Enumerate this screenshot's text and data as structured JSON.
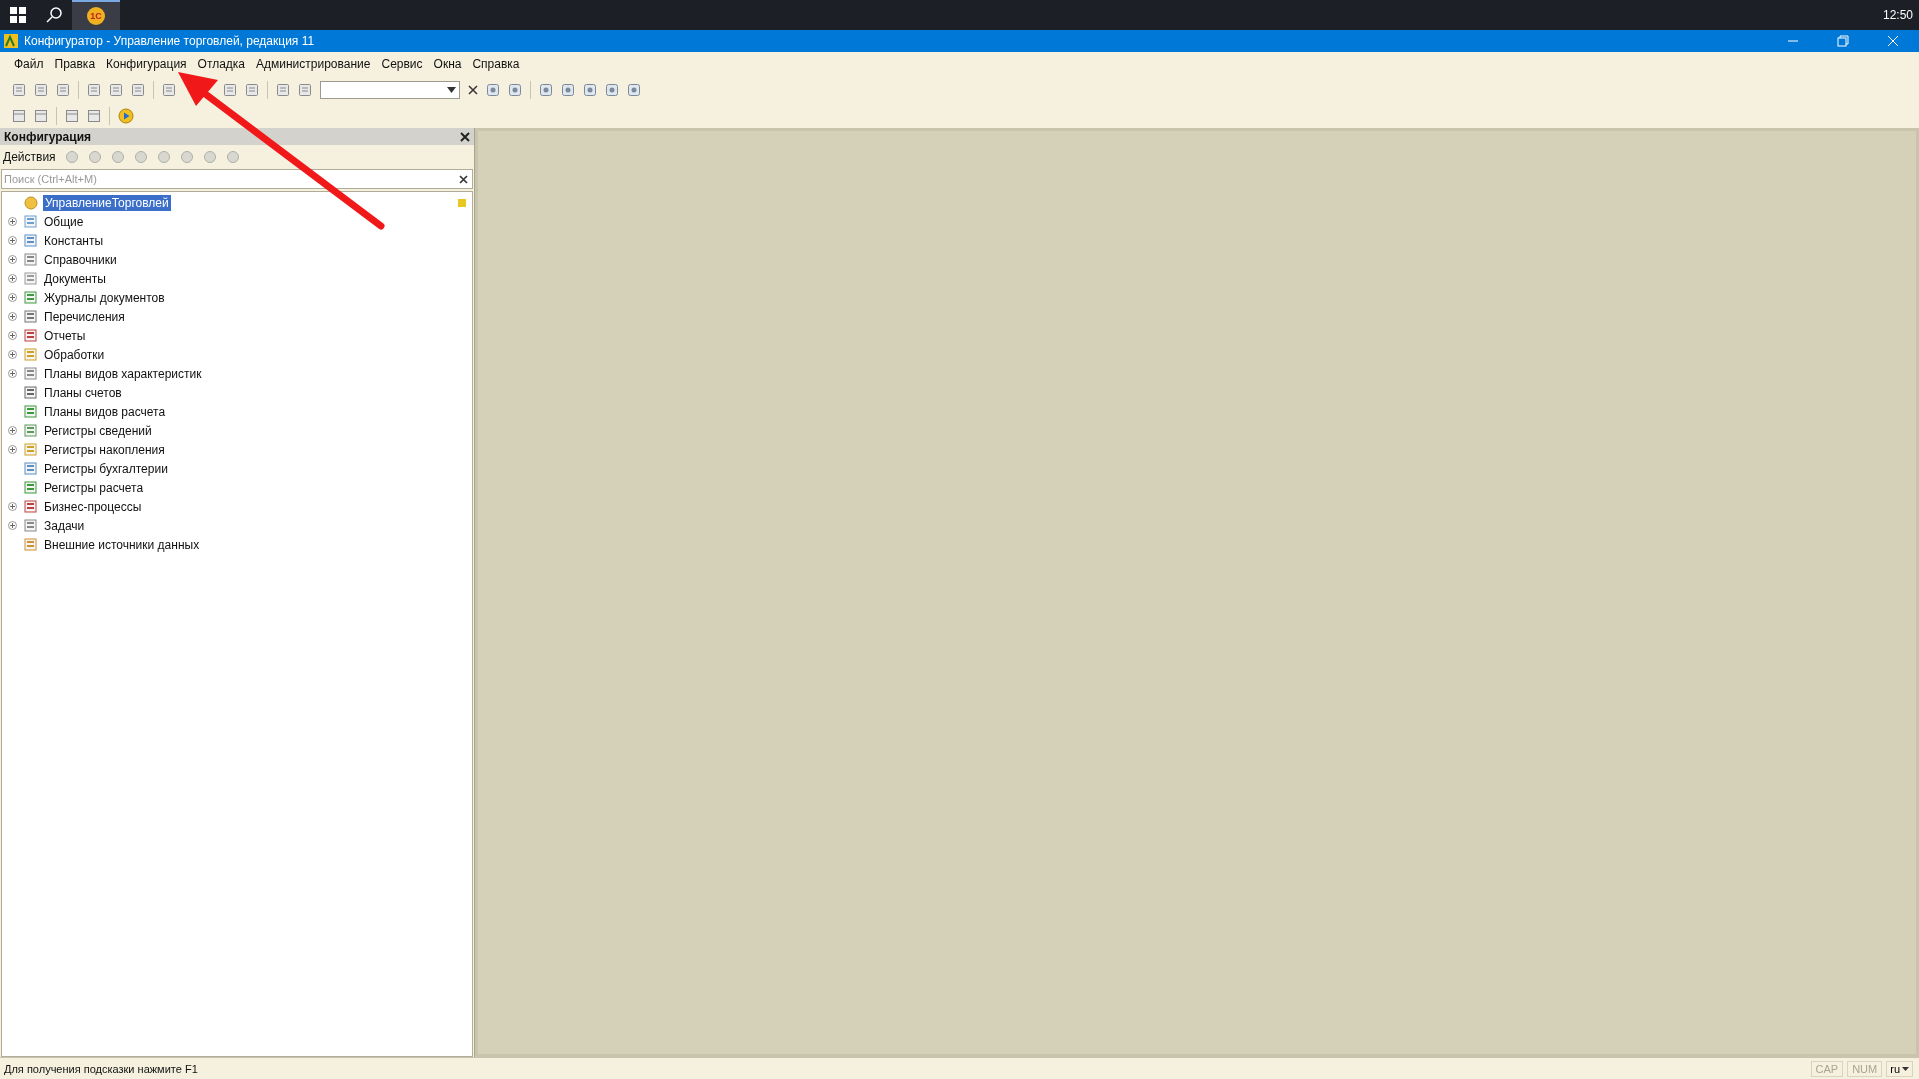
{
  "taskbar": {
    "app_label": "1С",
    "clock": "12:50"
  },
  "window": {
    "title": "Конфигуратор - Управление торговлей, редакция 11"
  },
  "menu": [
    "Файл",
    "Правка",
    "Конфигурация",
    "Отладка",
    "Администрирование",
    "Сервис",
    "Окна",
    "Справка"
  ],
  "panel": {
    "title": "Конфигурация",
    "actions_label": "Действия",
    "search": {
      "placeholder": "Поиск (Ctrl+Alt+M)"
    },
    "tree": [
      {
        "label": "УправлениеТорговлей",
        "selected": true
      },
      {
        "label": "Общие",
        "expanded": false,
        "selected": false
      },
      {
        "label": "Константы",
        "expanded": false,
        "selected": false
      },
      {
        "label": "Справочники",
        "expanded": false,
        "selected": false
      },
      {
        "label": "Документы",
        "expanded": false,
        "selected": false
      },
      {
        "label": "Журналы документов",
        "expanded": false,
        "selected": false
      },
      {
        "label": "Перечисления",
        "expanded": false,
        "selected": false
      },
      {
        "label": "Отчеты",
        "expanded": false,
        "selected": false
      },
      {
        "label": "Обработки",
        "expanded": false,
        "selected": false
      },
      {
        "label": "Планы видов характеристик",
        "expanded": false,
        "selected": false
      },
      {
        "label": "Планы счетов",
        "selected": false
      },
      {
        "label": "Планы видов расчета",
        "selected": false
      },
      {
        "label": "Регистры сведений",
        "expanded": false,
        "selected": false
      },
      {
        "label": "Регистры накопления",
        "expanded": false,
        "selected": false
      },
      {
        "label": "Регистры бухгалтерии",
        "selected": false
      },
      {
        "label": "Регистры расчета",
        "selected": false
      },
      {
        "label": "Бизнес-процессы",
        "expanded": false,
        "selected": false
      },
      {
        "label": "Задачи",
        "expanded": false,
        "selected": false
      },
      {
        "label": "Внешние источники данных",
        "selected": false
      }
    ]
  },
  "status_bar": {
    "hint": "Для получения подсказки нажмите F1",
    "indicators": [
      {
        "label": "CAP",
        "on": false
      },
      {
        "label": "NUM",
        "on": false
      }
    ],
    "language": "ru"
  }
}
